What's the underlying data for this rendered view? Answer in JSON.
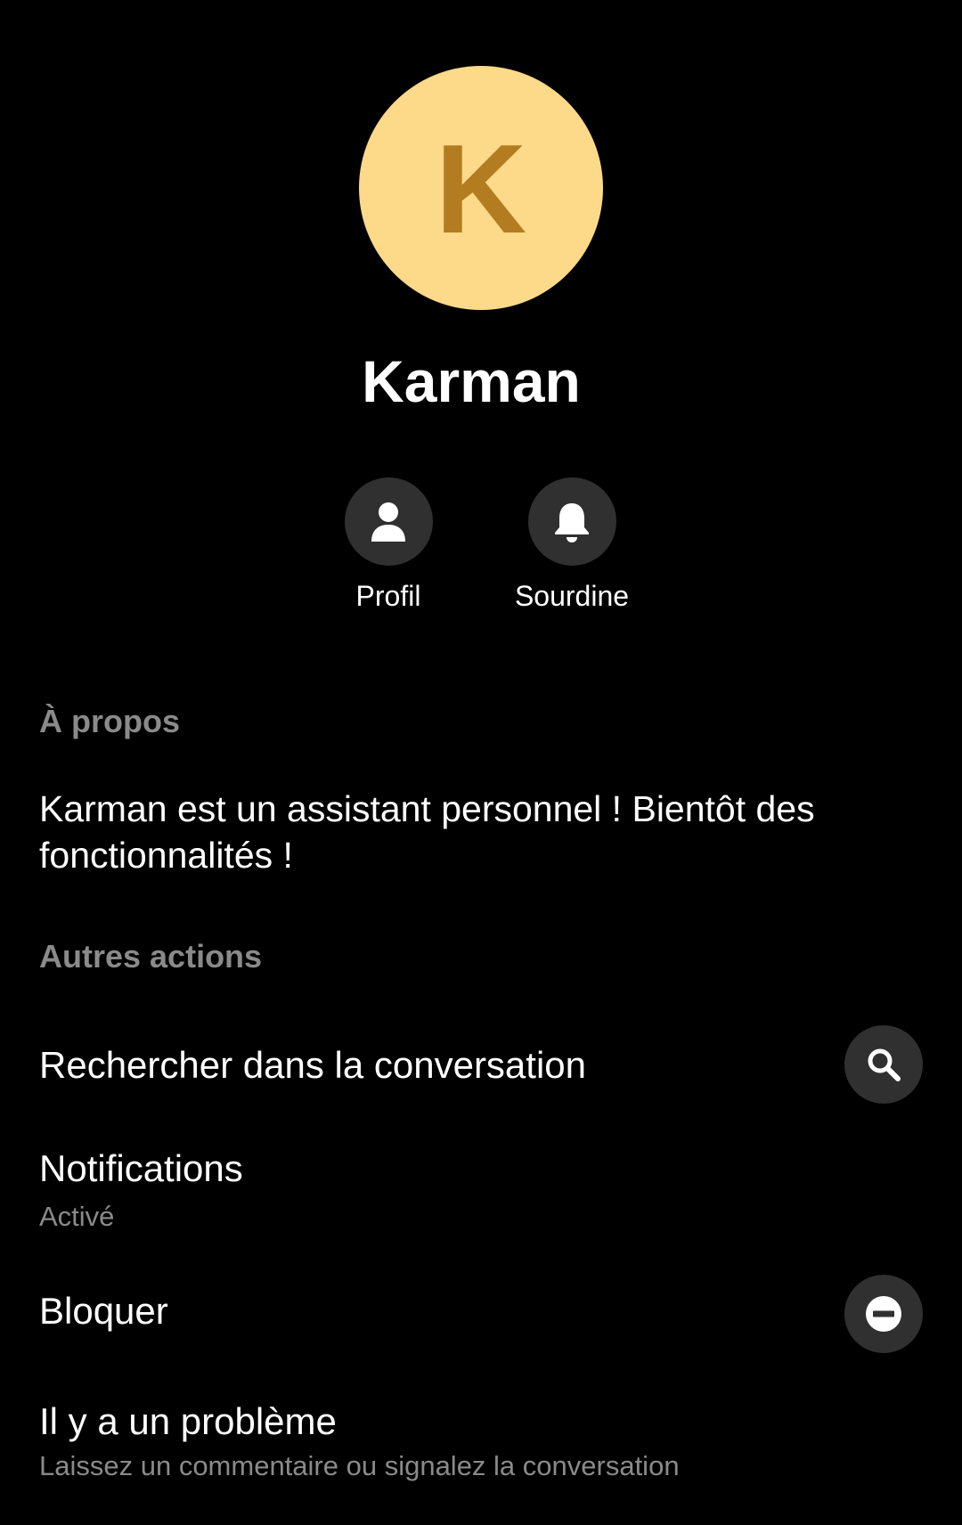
{
  "contact": {
    "avatar_letter": "K",
    "name": "Karman"
  },
  "quick_actions": [
    {
      "label": "Profil",
      "icon": "person-icon"
    },
    {
      "label": "Sourdine",
      "icon": "bell-icon"
    }
  ],
  "about": {
    "header": "À propos",
    "text": "Karman est un assistant personnel ! Bientôt des fonctionnalités !"
  },
  "other_actions": {
    "header": "Autres actions",
    "items": [
      {
        "title": "Rechercher dans la conversation",
        "icon": "search-icon"
      },
      {
        "title": "Notifications",
        "subtitle": "Activé"
      },
      {
        "title": "Bloquer",
        "icon": "block-icon"
      },
      {
        "title": "Il y a un problème",
        "subtitle": "Laissez un commentaire ou signalez la conversation"
      }
    ]
  },
  "colors": {
    "background": "#000000",
    "avatar_bg": "#fdd98a",
    "avatar_letter": "#b47c20",
    "icon_circle": "#303030",
    "secondary_text": "#8a8a8a"
  }
}
